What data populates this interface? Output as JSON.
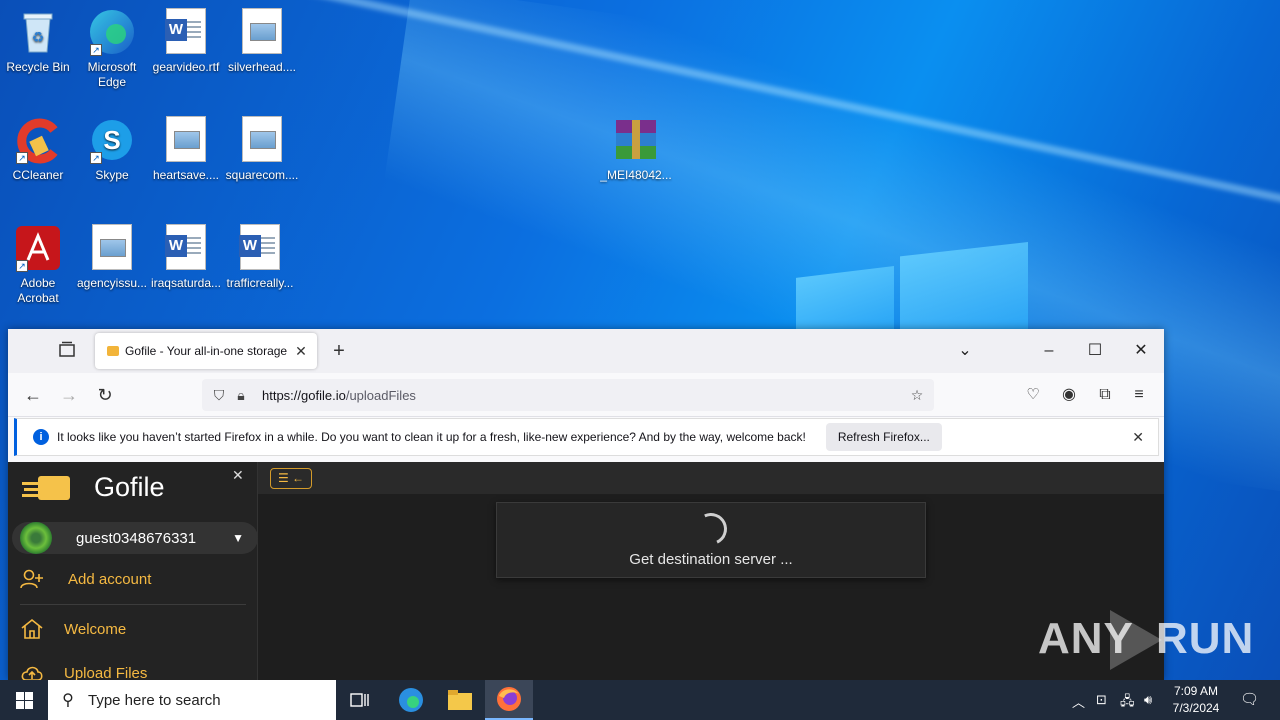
{
  "desktop": {
    "icons": [
      {
        "label": "Recycle Bin"
      },
      {
        "label": "Microsoft Edge"
      },
      {
        "label": "gearvideo.rtf"
      },
      {
        "label": "silverhead...."
      },
      {
        "label": "CCleaner"
      },
      {
        "label": "Skype"
      },
      {
        "label": "heartsave...."
      },
      {
        "label": "squarecom...."
      },
      {
        "label": "_MEI48042..."
      },
      {
        "label": "Adobe Acrobat"
      },
      {
        "label": "agencyissu..."
      },
      {
        "label": "iraqsaturda..."
      },
      {
        "label": "trafficreally..."
      }
    ],
    "watermark": {
      "left": "ANY",
      "right": "RUN"
    }
  },
  "browser": {
    "tab_title": "Gofile - Your all-in-one storage",
    "url_host": "https://gofile.io",
    "url_path": "/uploadFiles",
    "notice_text": "It looks like you haven’t started Firefox in a while. Do you want to clean it up for a fresh, like-new experience? And by the way, welcome back!",
    "notice_button": "Refresh Firefox..."
  },
  "gofile": {
    "brand": "Gofile",
    "account_name": "guest0348676331",
    "menu": [
      {
        "label": "Add account"
      },
      {
        "label": "Welcome"
      },
      {
        "label": "Upload Files"
      }
    ],
    "status_text": "Get destination server ..."
  },
  "taskbar": {
    "search_placeholder": "Type here to search",
    "time": "7:09 AM",
    "date": "7/3/2024"
  },
  "colors": {
    "accent": "#f5b942",
    "firefox_blue": "#0060df",
    "page_bg": "#1e1e1e"
  }
}
